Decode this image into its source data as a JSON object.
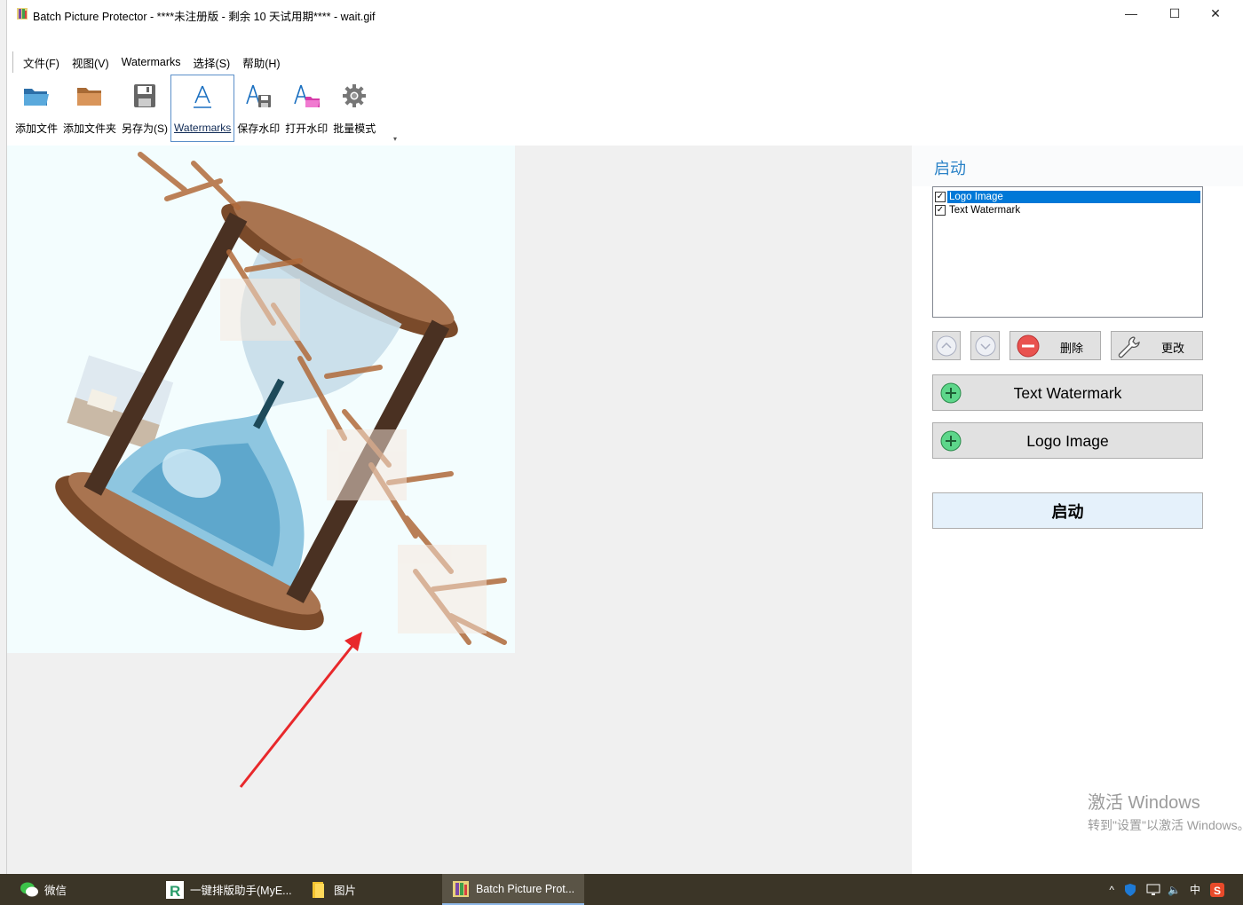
{
  "window": {
    "title": "Batch Picture Protector - ****未注册版 - 剩余 10 天试用期**** - wait.gif",
    "minimize": "—",
    "maximize": "☐",
    "close": "✕"
  },
  "menu": [
    "文件(F)",
    "视图(V)",
    "Watermarks",
    "选择(S)",
    "帮助(H)"
  ],
  "toolbar": {
    "items": [
      {
        "label": "添加文件",
        "icon": "folder-open-icon"
      },
      {
        "label": "添加文件夹",
        "icon": "folder-icon"
      },
      {
        "label": "另存为(S)",
        "icon": "floppy-disk-icon"
      },
      {
        "label": "Watermarks",
        "icon": "letter-a-icon",
        "active": true
      },
      {
        "label": "保存水印",
        "icon": "save-watermark-icon"
      },
      {
        "label": "打开水印",
        "icon": "open-watermark-icon"
      },
      {
        "label": "批量模式",
        "icon": "gear-icon"
      }
    ],
    "overflow": "▾"
  },
  "panel": {
    "title": "启动",
    "watermarks": [
      {
        "label": "Logo Image",
        "checked": true,
        "selected": true
      },
      {
        "label": "Text Watermark",
        "checked": true,
        "selected": false
      }
    ],
    "delete_label": "删除",
    "edit_label": "更改",
    "add_text_label": "Text Watermark",
    "add_logo_label": "Logo Image",
    "start_label": "启动"
  },
  "activation": {
    "line1": "激活 Windows",
    "line2": "转到\"设置\"以激活 Windows。"
  },
  "taskbar": {
    "items": [
      {
        "label": "微信",
        "icon": "wechat-icon"
      },
      {
        "label": "一键排版助手(MyE...",
        "icon": "myeditor-icon"
      },
      {
        "label": "图片",
        "icon": "file-explorer-icon"
      },
      {
        "label": "Batch Picture Prot...",
        "icon": "batch-picture-protector-icon",
        "active": true
      }
    ],
    "tray_ime": "中"
  },
  "colors": {
    "accent": "#2a82c7",
    "selection": "#0078d7",
    "taskbar": "#3b3527",
    "canvas_bg": "#f0f0f0"
  }
}
